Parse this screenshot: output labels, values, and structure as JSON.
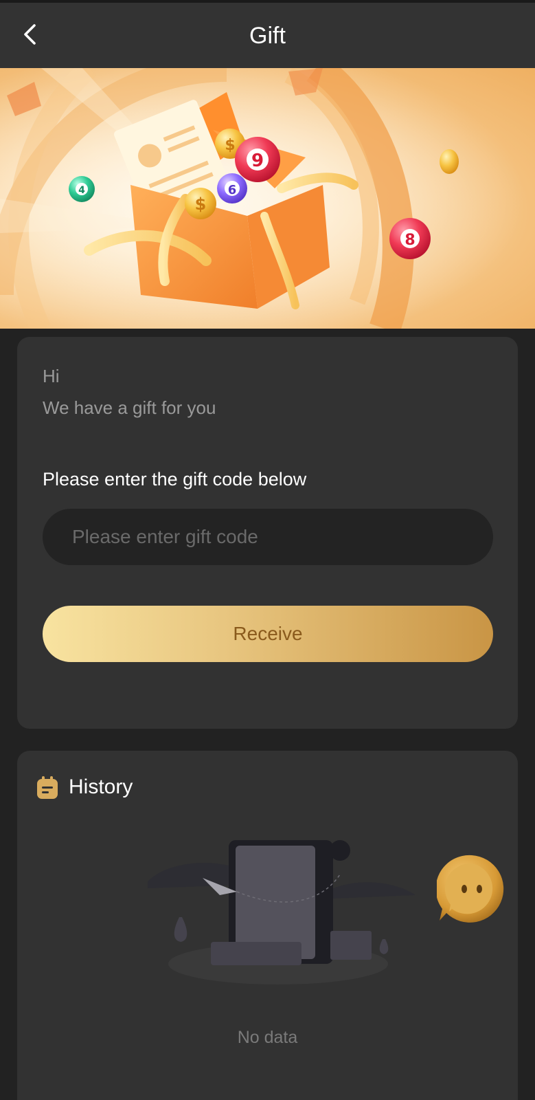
{
  "header": {
    "title": "Gift",
    "back_icon": "chevron-left-icon"
  },
  "banner": {
    "image": "gift-box-banner",
    "lottery_ball_numbers": [
      "4",
      "9",
      "6",
      "8"
    ]
  },
  "gift_card": {
    "greeting": "Hi",
    "message": "We have a gift for you",
    "prompt": "Please enter the gift code below",
    "input_placeholder": "Please enter gift code",
    "input_value": "",
    "button_label": "Receive"
  },
  "history": {
    "icon": "calendar-note-icon",
    "title": "History",
    "empty_label": "No data"
  },
  "support": {
    "icon": "chat-bubble-icon"
  },
  "colors": {
    "background": "#222222",
    "card": "#323232",
    "accent_gold": "#d9ac5e",
    "button_text": "#8a5a1c",
    "banner_orange": "#f4a445"
  }
}
